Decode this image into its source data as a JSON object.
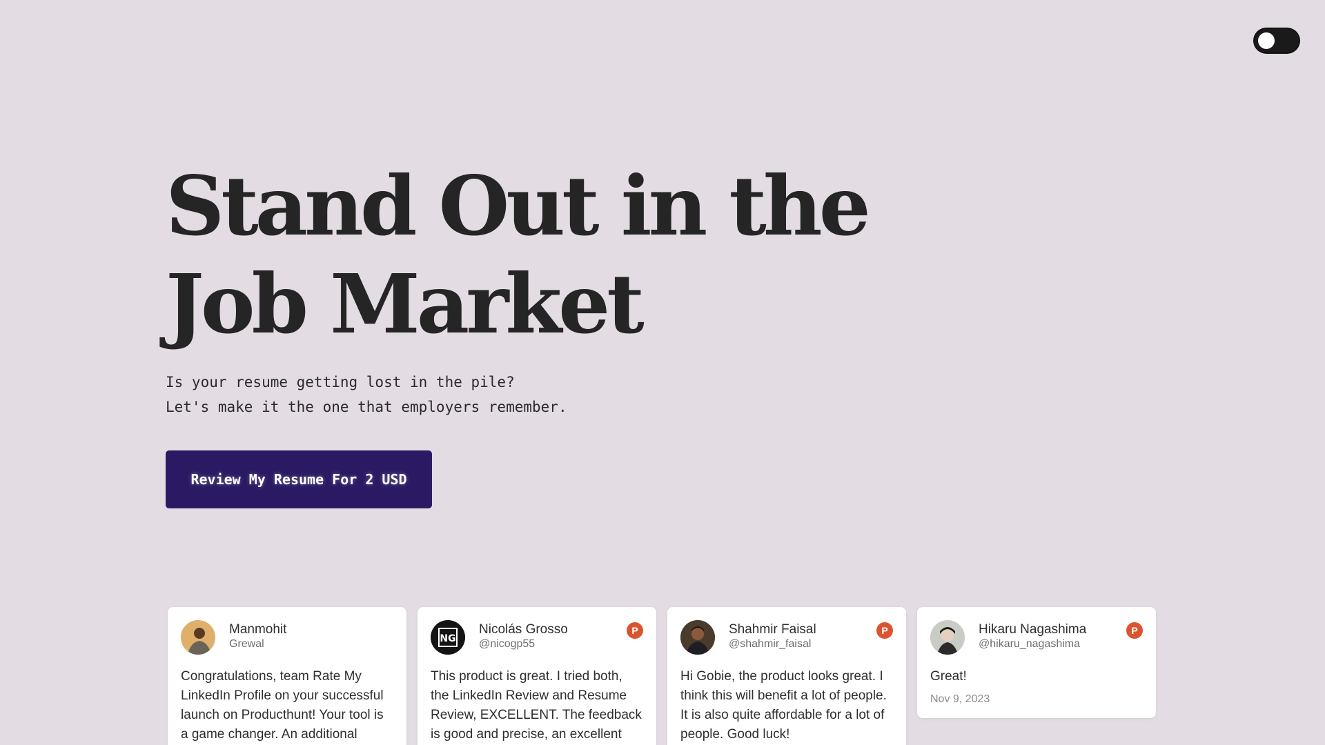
{
  "theme_toggle": {
    "state": "off"
  },
  "hero": {
    "title": "Stand Out in the Job Market",
    "subtitle_line1": "Is your resume getting lost in the pile?",
    "subtitle_line2": "Let's make it the one that employers remember.",
    "cta_label": "Review My Resume For 2 USD"
  },
  "colors": {
    "background": "#e3dde3",
    "cta": "#2b1a63",
    "producthunt": "#da552f"
  },
  "testimonials": [
    {
      "name": "Manmohit",
      "handle": "Grewal",
      "has_badge": false,
      "text": "Congratulations, team Rate My LinkedIn Profile on your successful launch on Producthunt! Your tool is a game changer. An additional smart feature would..."
    },
    {
      "name": "Nicolás Grosso",
      "handle": "@nicogp55",
      "has_badge": true,
      "badge": "P",
      "avatar_text": "NG",
      "text": "This product is great. I tried both, the LinkedIn Review and Resume Review, EXCELLENT. The feedback is good and precise, an excellent way to understand what to change..."
    },
    {
      "name": "Shahmir Faisal",
      "handle": "@shahmir_faisal",
      "has_badge": true,
      "badge": "P",
      "text": "Hi Gobie, the product looks great. I think this will benefit a lot of people. It is also quite affordable for a lot of people. Good luck!"
    },
    {
      "name": "Hikaru Nagashima",
      "handle": "@hikaru_nagashima",
      "has_badge": true,
      "badge": "P",
      "text": "Great!",
      "date": "Nov 9, 2023"
    }
  ]
}
